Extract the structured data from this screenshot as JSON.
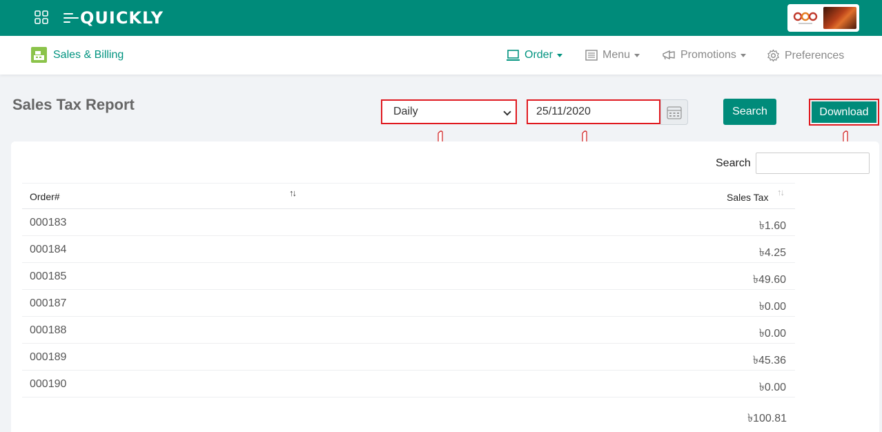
{
  "header": {
    "logo_text": "QUICKLY"
  },
  "navbar": {
    "brand_label": "Sales & Billing",
    "items": [
      {
        "label": "Order",
        "icon": "order-icon",
        "active": true
      },
      {
        "label": "Menu",
        "icon": "menu-list-icon",
        "active": false
      },
      {
        "label": "Promotions",
        "icon": "megaphone-icon",
        "active": false
      },
      {
        "label": "Preferences",
        "icon": "gear-icon",
        "active": false
      }
    ]
  },
  "report": {
    "title": "Sales Tax Report",
    "period_value": "Daily",
    "date_value": "25/11/2020",
    "search_button": "Search",
    "download_button": "Download"
  },
  "table": {
    "search_label": "Search",
    "search_value": "",
    "columns": [
      "Order#",
      "Sales Tax"
    ],
    "rows": [
      {
        "order": "000183",
        "tax": "৳1.60"
      },
      {
        "order": "000184",
        "tax": "৳4.25"
      },
      {
        "order": "000185",
        "tax": "৳49.60"
      },
      {
        "order": "000187",
        "tax": "৳0.00"
      },
      {
        "order": "000188",
        "tax": "৳0.00"
      },
      {
        "order": "000189",
        "tax": "৳45.36"
      },
      {
        "order": "000190",
        "tax": "৳0.00"
      }
    ],
    "total": "৳100.81"
  },
  "colors": {
    "primary": "#008b7a",
    "accent_text": "#00937f",
    "highlight": "#e0191f"
  }
}
